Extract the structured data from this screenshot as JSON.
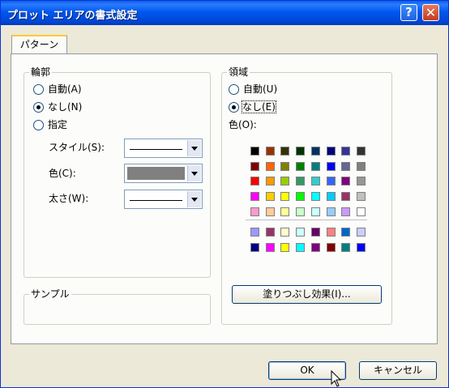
{
  "window": {
    "title": "プロット エリアの書式設定",
    "help_label": "?",
    "close_label": "✕"
  },
  "tabs": [
    {
      "label": "パターン"
    }
  ],
  "border": {
    "group_label": "輪郭",
    "options": [
      {
        "label": "自動(A)",
        "checked": false
      },
      {
        "label": "なし(N)",
        "checked": true
      },
      {
        "label": "指定",
        "checked": false
      }
    ],
    "style_label": "スタイル(S):",
    "color_label": "色(C):",
    "color_value": "#808080",
    "weight_label": "太さ(W):"
  },
  "area": {
    "group_label": "領域",
    "options": [
      {
        "label": "自動(U)",
        "checked": false
      },
      {
        "label": "なし(E)",
        "checked": true
      }
    ],
    "color_label": "色(O):",
    "palette_top": [
      [
        "#000000",
        "#993300",
        "#333300",
        "#003300",
        "#003366",
        "#000080",
        "#333399",
        "#333333"
      ],
      [
        "#800000",
        "#FF6600",
        "#808000",
        "#008000",
        "#008080",
        "#0000FF",
        "#666699",
        "#808080"
      ],
      [
        "#FF0000",
        "#FF9900",
        "#99CC00",
        "#339966",
        "#33CCCC",
        "#3366FF",
        "#800080",
        "#969696"
      ],
      [
        "#FF00FF",
        "#FFCC00",
        "#FFFF00",
        "#00FF00",
        "#00FFFF",
        "#00CCFF",
        "#993366",
        "#C0C0C0"
      ],
      [
        "#FF99CC",
        "#FFCC99",
        "#FFFF99",
        "#CCFFCC",
        "#CCFFFF",
        "#99CCFF",
        "#CC99FF",
        "#FFFFFF"
      ]
    ],
    "palette_bottom": [
      [
        "#9999FF",
        "#993366",
        "#FFFFCC",
        "#CCFFFF",
        "#660066",
        "#FF8080",
        "#0066CC",
        "#CCCCFF"
      ],
      [
        "#000080",
        "#FF00FF",
        "#FFFF00",
        "#00FFFF",
        "#800080",
        "#800000",
        "#008080",
        "#0000FF"
      ]
    ],
    "fill_effects_label": "塗りつぶし効果(I)..."
  },
  "sample": {
    "group_label": "サンプル"
  },
  "buttons": {
    "ok_label": "OK",
    "cancel_label": "キャンセル"
  }
}
